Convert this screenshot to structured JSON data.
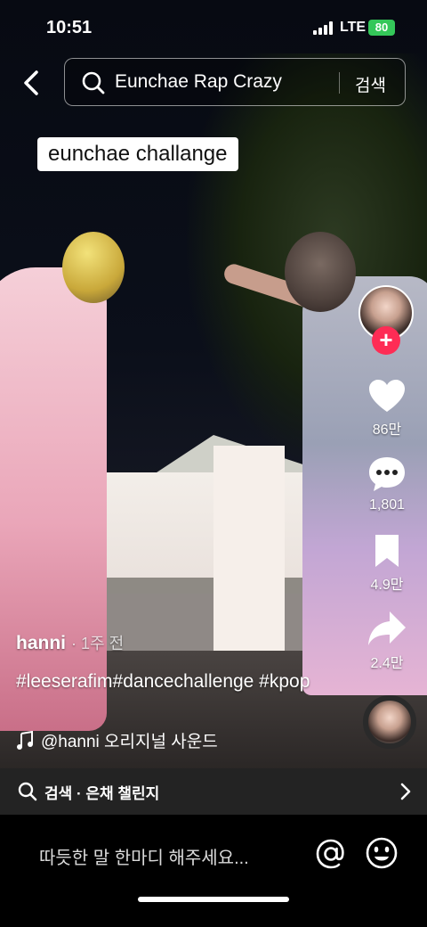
{
  "status_bar": {
    "time": "10:51",
    "network": "LTE",
    "battery": "80"
  },
  "search": {
    "query": "Eunchae Rap Crazy",
    "submit_label": "검색"
  },
  "video": {
    "caption_overlay": "eunchae challange"
  },
  "actions": {
    "likes": "86만",
    "comments": "1,801",
    "saves": "4.9만",
    "shares": "2.4만"
  },
  "post": {
    "author": "hanni",
    "time_ago": "· 1주 전",
    "description": "#leeserafim#dancechallenge #kpop",
    "sound": "@hanni 오리지널 사운드"
  },
  "related_search": {
    "text": "검색 · 은채 챌린지"
  },
  "comment_bar": {
    "placeholder": "따듯한 말 한마디 해주세요..."
  },
  "colors": {
    "follow_accent": "#fe2c55",
    "battery_green": "#34c759",
    "related_bar_bg": "#232323"
  },
  "icons": [
    "chevron-left-icon",
    "search-icon",
    "plus-icon",
    "heart-icon",
    "comment-icon",
    "bookmark-icon",
    "share-icon",
    "music-note-icon",
    "chevron-right-icon",
    "at-icon",
    "emoji-icon"
  ]
}
